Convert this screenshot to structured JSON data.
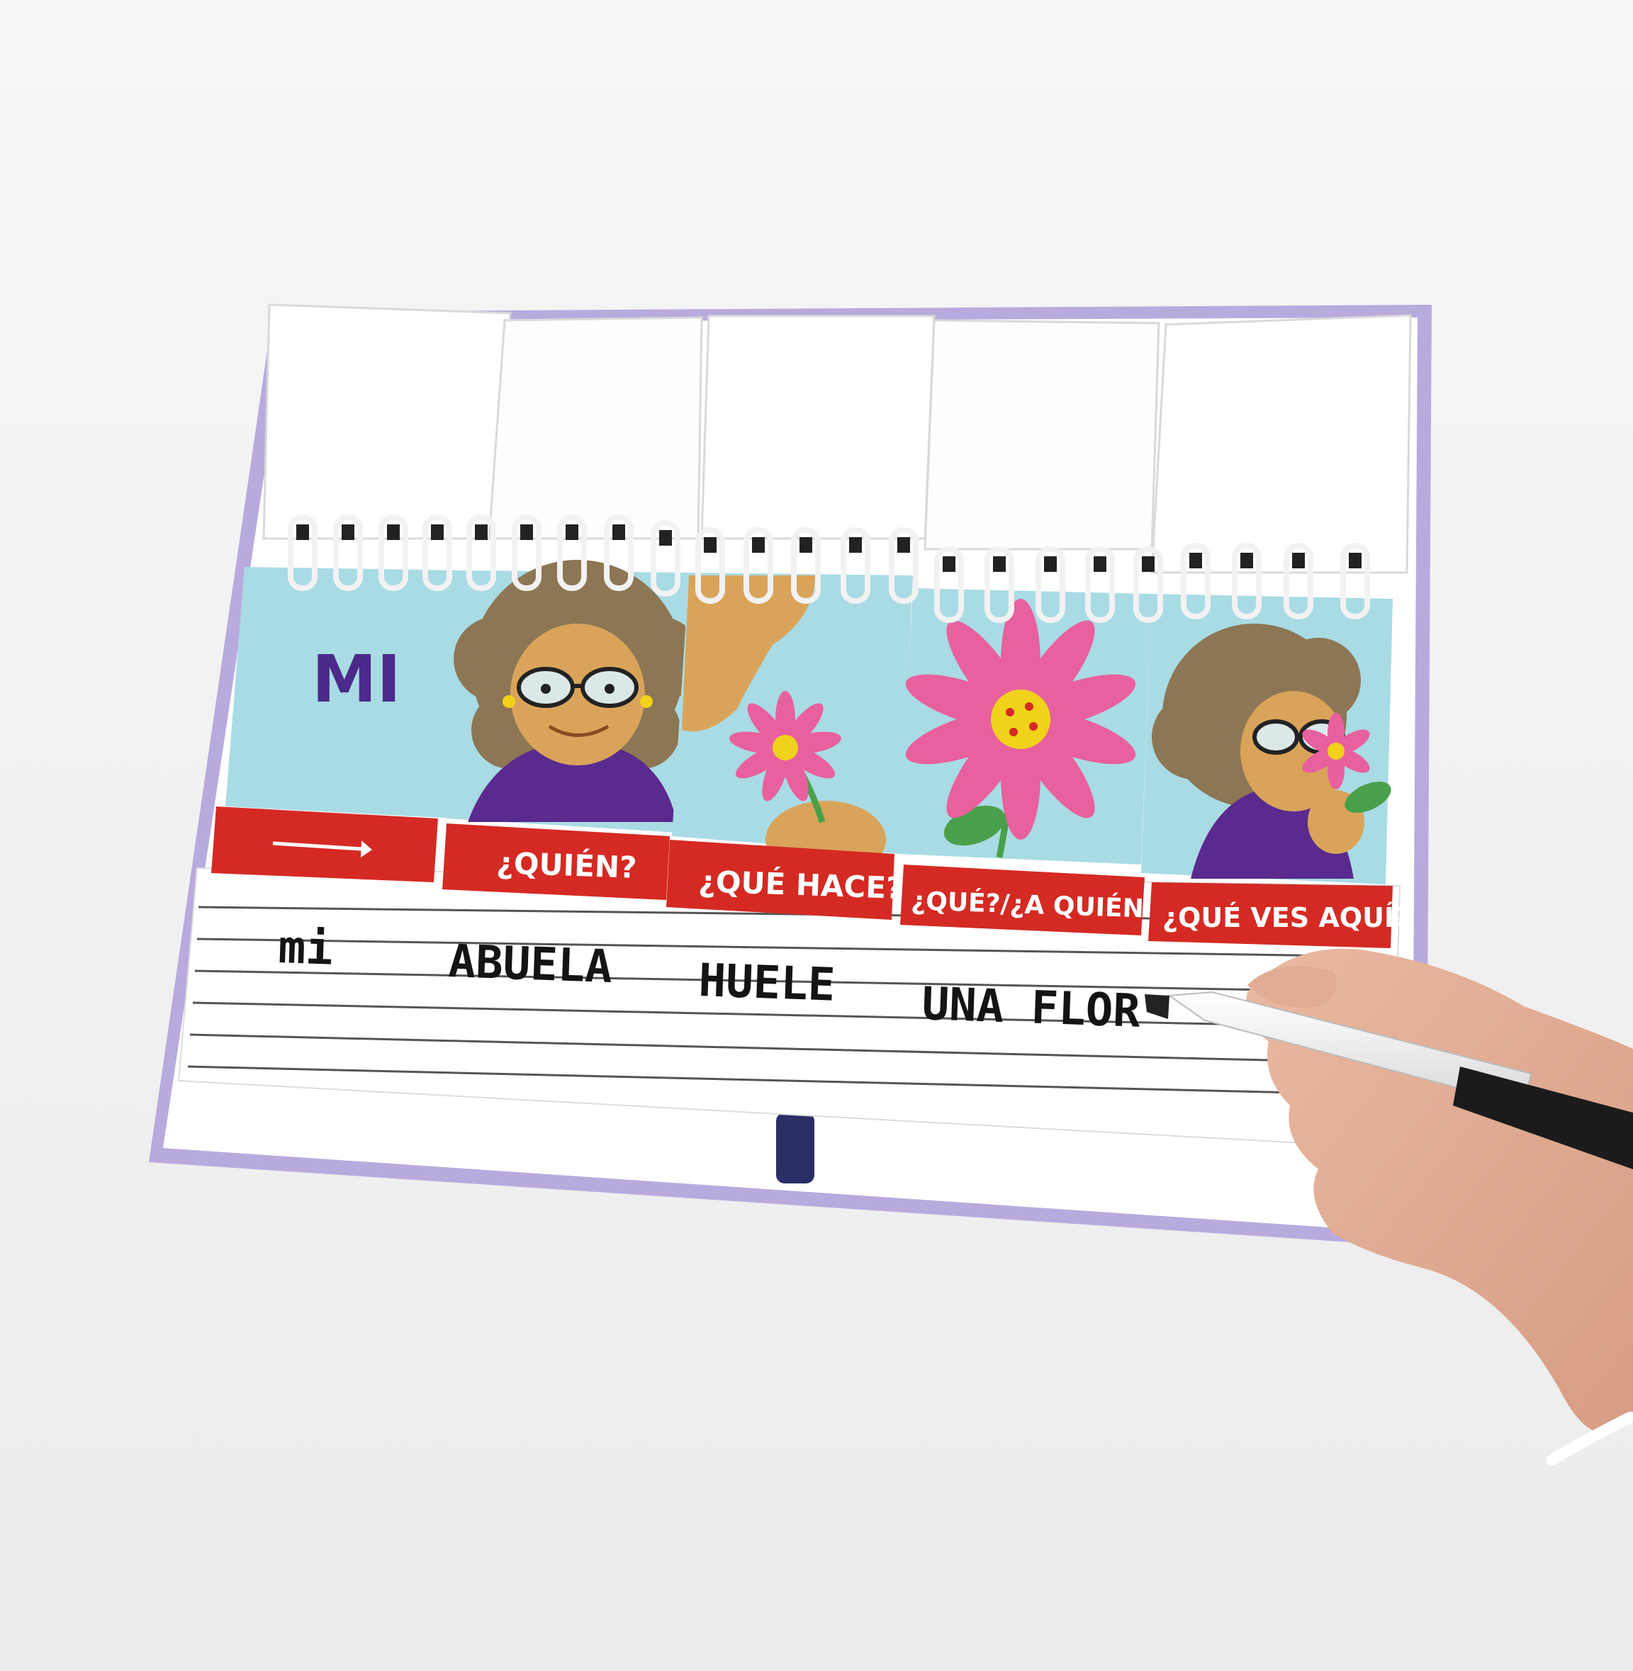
{
  "cards": [
    {
      "label": "→",
      "word": "MI"
    },
    {
      "label": "¿QUIÉN?"
    },
    {
      "label": "¿QUÉ HACE?"
    },
    {
      "label": "¿QUÉ?/¿A QUIÉN?"
    },
    {
      "label": "¿QUÉ VES AQUÍ?"
    }
  ],
  "handwriting": {
    "w1": "mi",
    "w2": "ABUELA",
    "w3": "HUELE",
    "w4": "UNA FLOR"
  },
  "colors": {
    "book_cover": "#b7a7dc",
    "card_bg": "#a9dbe4",
    "label_red": "#d42a23",
    "hair": "#8c7654",
    "skin": "#d9a45a",
    "shirt": "#5a2a8e",
    "flower_petal": "#e8609e",
    "flower_center": "#f0d21b"
  }
}
